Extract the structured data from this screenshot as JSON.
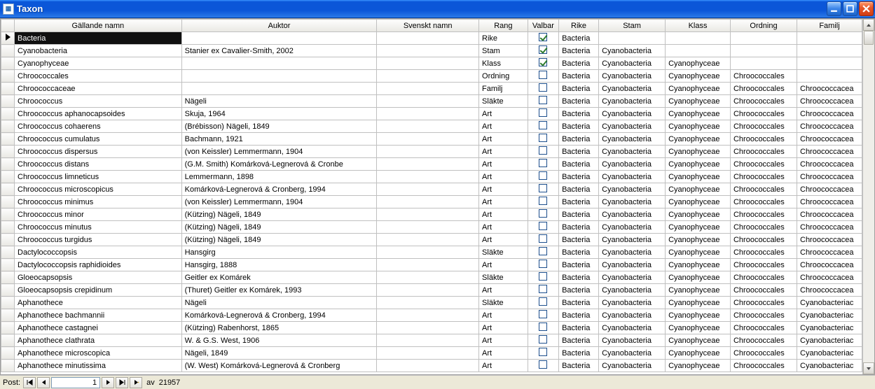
{
  "window": {
    "title": "Taxon"
  },
  "columns": {
    "name": "Gällande namn",
    "auktor": "Auktor",
    "svenskt": "Svenskt namn",
    "rang": "Rang",
    "valbar": "Valbar",
    "rike": "Rike",
    "stam": "Stam",
    "klass": "Klass",
    "ordning": "Ordning",
    "familj": "Familj"
  },
  "rows": [
    {
      "sel": true,
      "name": "Bacteria",
      "auktor": "",
      "sv": "",
      "rang": "Rike",
      "val": true,
      "rike": "Bacteria",
      "stam": "",
      "klass": "",
      "ord": "",
      "fam": ""
    },
    {
      "sel": false,
      "name": "Cyanobacteria",
      "auktor": "Stanier ex Cavalier-Smith, 2002",
      "sv": "",
      "rang": "Stam",
      "val": true,
      "rike": "Bacteria",
      "stam": "Cyanobacteria",
      "klass": "",
      "ord": "",
      "fam": ""
    },
    {
      "sel": false,
      "name": "Cyanophyceae",
      "auktor": "",
      "sv": "",
      "rang": "Klass",
      "val": true,
      "rike": "Bacteria",
      "stam": "Cyanobacteria",
      "klass": "Cyanophyceae",
      "ord": "",
      "fam": ""
    },
    {
      "sel": false,
      "name": "Chroococcales",
      "auktor": "",
      "sv": "",
      "rang": "Ordning",
      "val": false,
      "rike": "Bacteria",
      "stam": "Cyanobacteria",
      "klass": "Cyanophyceae",
      "ord": "Chroococcales",
      "fam": ""
    },
    {
      "sel": false,
      "name": "Chroococcaceae",
      "auktor": "",
      "sv": "",
      "rang": "Familj",
      "val": false,
      "rike": "Bacteria",
      "stam": "Cyanobacteria",
      "klass": "Cyanophyceae",
      "ord": "Chroococcales",
      "fam": "Chroococcacea"
    },
    {
      "sel": false,
      "name": "Chroococcus",
      "auktor": "Nägeli",
      "sv": "",
      "rang": "Släkte",
      "val": false,
      "rike": "Bacteria",
      "stam": "Cyanobacteria",
      "klass": "Cyanophyceae",
      "ord": "Chroococcales",
      "fam": "Chroococcacea"
    },
    {
      "sel": false,
      "name": "Chroococcus aphanocapsoides",
      "auktor": "Skuja, 1964",
      "sv": "",
      "rang": "Art",
      "val": false,
      "rike": "Bacteria",
      "stam": "Cyanobacteria",
      "klass": "Cyanophyceae",
      "ord": "Chroococcales",
      "fam": "Chroococcacea"
    },
    {
      "sel": false,
      "name": "Chroococcus cohaerens",
      "auktor": "(Brébisson) Nägeli, 1849",
      "sv": "",
      "rang": "Art",
      "val": false,
      "rike": "Bacteria",
      "stam": "Cyanobacteria",
      "klass": "Cyanophyceae",
      "ord": "Chroococcales",
      "fam": "Chroococcacea"
    },
    {
      "sel": false,
      "name": "Chroococcus cumulatus",
      "auktor": "Bachmann, 1921",
      "sv": "",
      "rang": "Art",
      "val": false,
      "rike": "Bacteria",
      "stam": "Cyanobacteria",
      "klass": "Cyanophyceae",
      "ord": "Chroococcales",
      "fam": "Chroococcacea"
    },
    {
      "sel": false,
      "name": "Chroococcus dispersus",
      "auktor": "(von Keissler) Lemmermann, 1904",
      "sv": "",
      "rang": "Art",
      "val": false,
      "rike": "Bacteria",
      "stam": "Cyanobacteria",
      "klass": "Cyanophyceae",
      "ord": "Chroococcales",
      "fam": "Chroococcacea"
    },
    {
      "sel": false,
      "name": "Chroococcus distans",
      "auktor": "(G.M. Smith) Komárková-Legnerová & Cronbe",
      "sv": "",
      "rang": "Art",
      "val": false,
      "rike": "Bacteria",
      "stam": "Cyanobacteria",
      "klass": "Cyanophyceae",
      "ord": "Chroococcales",
      "fam": "Chroococcacea"
    },
    {
      "sel": false,
      "name": "Chroococcus limneticus",
      "auktor": "Lemmermann, 1898",
      "sv": "",
      "rang": "Art",
      "val": false,
      "rike": "Bacteria",
      "stam": "Cyanobacteria",
      "klass": "Cyanophyceae",
      "ord": "Chroococcales",
      "fam": "Chroococcacea"
    },
    {
      "sel": false,
      "name": "Chroococcus microscopicus",
      "auktor": "Komárková-Legnerová & Cronberg, 1994",
      "sv": "",
      "rang": "Art",
      "val": false,
      "rike": "Bacteria",
      "stam": "Cyanobacteria",
      "klass": "Cyanophyceae",
      "ord": "Chroococcales",
      "fam": "Chroococcacea"
    },
    {
      "sel": false,
      "name": "Chroococcus minimus",
      "auktor": "(von Keissler) Lemmermann, 1904",
      "sv": "",
      "rang": "Art",
      "val": false,
      "rike": "Bacteria",
      "stam": "Cyanobacteria",
      "klass": "Cyanophyceae",
      "ord": "Chroococcales",
      "fam": "Chroococcacea"
    },
    {
      "sel": false,
      "name": "Chroococcus minor",
      "auktor": "(Kützing) Nägeli, 1849",
      "sv": "",
      "rang": "Art",
      "val": false,
      "rike": "Bacteria",
      "stam": "Cyanobacteria",
      "klass": "Cyanophyceae",
      "ord": "Chroococcales",
      "fam": "Chroococcacea"
    },
    {
      "sel": false,
      "name": "Chroococcus minutus",
      "auktor": "(Kützing) Nägeli, 1849",
      "sv": "",
      "rang": "Art",
      "val": false,
      "rike": "Bacteria",
      "stam": "Cyanobacteria",
      "klass": "Cyanophyceae",
      "ord": "Chroococcales",
      "fam": "Chroococcacea"
    },
    {
      "sel": false,
      "name": "Chroococcus turgidus",
      "auktor": "(Kützing) Nägeli, 1849",
      "sv": "",
      "rang": "Art",
      "val": false,
      "rike": "Bacteria",
      "stam": "Cyanobacteria",
      "klass": "Cyanophyceae",
      "ord": "Chroococcales",
      "fam": "Chroococcacea"
    },
    {
      "sel": false,
      "name": "Dactylococcopsis",
      "auktor": "Hansgirg",
      "sv": "",
      "rang": "Släkte",
      "val": false,
      "rike": "Bacteria",
      "stam": "Cyanobacteria",
      "klass": "Cyanophyceae",
      "ord": "Chroococcales",
      "fam": "Chroococcacea"
    },
    {
      "sel": false,
      "name": "Dactylococcopsis raphidioides",
      "auktor": "Hansgirg, 1888",
      "sv": "",
      "rang": "Art",
      "val": false,
      "rike": "Bacteria",
      "stam": "Cyanobacteria",
      "klass": "Cyanophyceae",
      "ord": "Chroococcales",
      "fam": "Chroococcacea"
    },
    {
      "sel": false,
      "name": "Gloeocapsopsis",
      "auktor": "Geitler ex Komárek",
      "sv": "",
      "rang": "Släkte",
      "val": false,
      "rike": "Bacteria",
      "stam": "Cyanobacteria",
      "klass": "Cyanophyceae",
      "ord": "Chroococcales",
      "fam": "Chroococcacea"
    },
    {
      "sel": false,
      "name": "Gloeocapsopsis crepidinum",
      "auktor": "(Thuret) Geitler ex Komárek, 1993",
      "sv": "",
      "rang": "Art",
      "val": false,
      "rike": "Bacteria",
      "stam": "Cyanobacteria",
      "klass": "Cyanophyceae",
      "ord": "Chroococcales",
      "fam": "Chroococcacea"
    },
    {
      "sel": false,
      "name": "Aphanothece",
      "auktor": "Nägeli",
      "sv": "",
      "rang": "Släkte",
      "val": false,
      "rike": "Bacteria",
      "stam": "Cyanobacteria",
      "klass": "Cyanophyceae",
      "ord": "Chroococcales",
      "fam": "Cyanobacteriac"
    },
    {
      "sel": false,
      "name": "Aphanothece bachmannii",
      "auktor": "Komárková-Legnerová & Cronberg, 1994",
      "sv": "",
      "rang": "Art",
      "val": false,
      "rike": "Bacteria",
      "stam": "Cyanobacteria",
      "klass": "Cyanophyceae",
      "ord": "Chroococcales",
      "fam": "Cyanobacteriac"
    },
    {
      "sel": false,
      "name": "Aphanothece castagnei",
      "auktor": "(Kützing) Rabenhorst, 1865",
      "sv": "",
      "rang": "Art",
      "val": false,
      "rike": "Bacteria",
      "stam": "Cyanobacteria",
      "klass": "Cyanophyceae",
      "ord": "Chroococcales",
      "fam": "Cyanobacteriac"
    },
    {
      "sel": false,
      "name": "Aphanothece clathrata",
      "auktor": "W. & G.S. West, 1906",
      "sv": "",
      "rang": "Art",
      "val": false,
      "rike": "Bacteria",
      "stam": "Cyanobacteria",
      "klass": "Cyanophyceae",
      "ord": "Chroococcales",
      "fam": "Cyanobacteriac"
    },
    {
      "sel": false,
      "name": "Aphanothece microscopica",
      "auktor": "Nägeli, 1849",
      "sv": "",
      "rang": "Art",
      "val": false,
      "rike": "Bacteria",
      "stam": "Cyanobacteria",
      "klass": "Cyanophyceae",
      "ord": "Chroococcales",
      "fam": "Cyanobacteriac"
    },
    {
      "sel": false,
      "name": "Aphanothece minutissima",
      "auktor": "(W. West) Komárková-Legnerová & Cronberg",
      "sv": "",
      "rang": "Art",
      "val": false,
      "rike": "Bacteria",
      "stam": "Cyanobacteria",
      "klass": "Cyanophyceae",
      "ord": "Chroococcales",
      "fam": "Cyanobacteriac"
    }
  ],
  "nav": {
    "label": "Post:",
    "current": "1",
    "of_label": "av",
    "total": "21957"
  }
}
